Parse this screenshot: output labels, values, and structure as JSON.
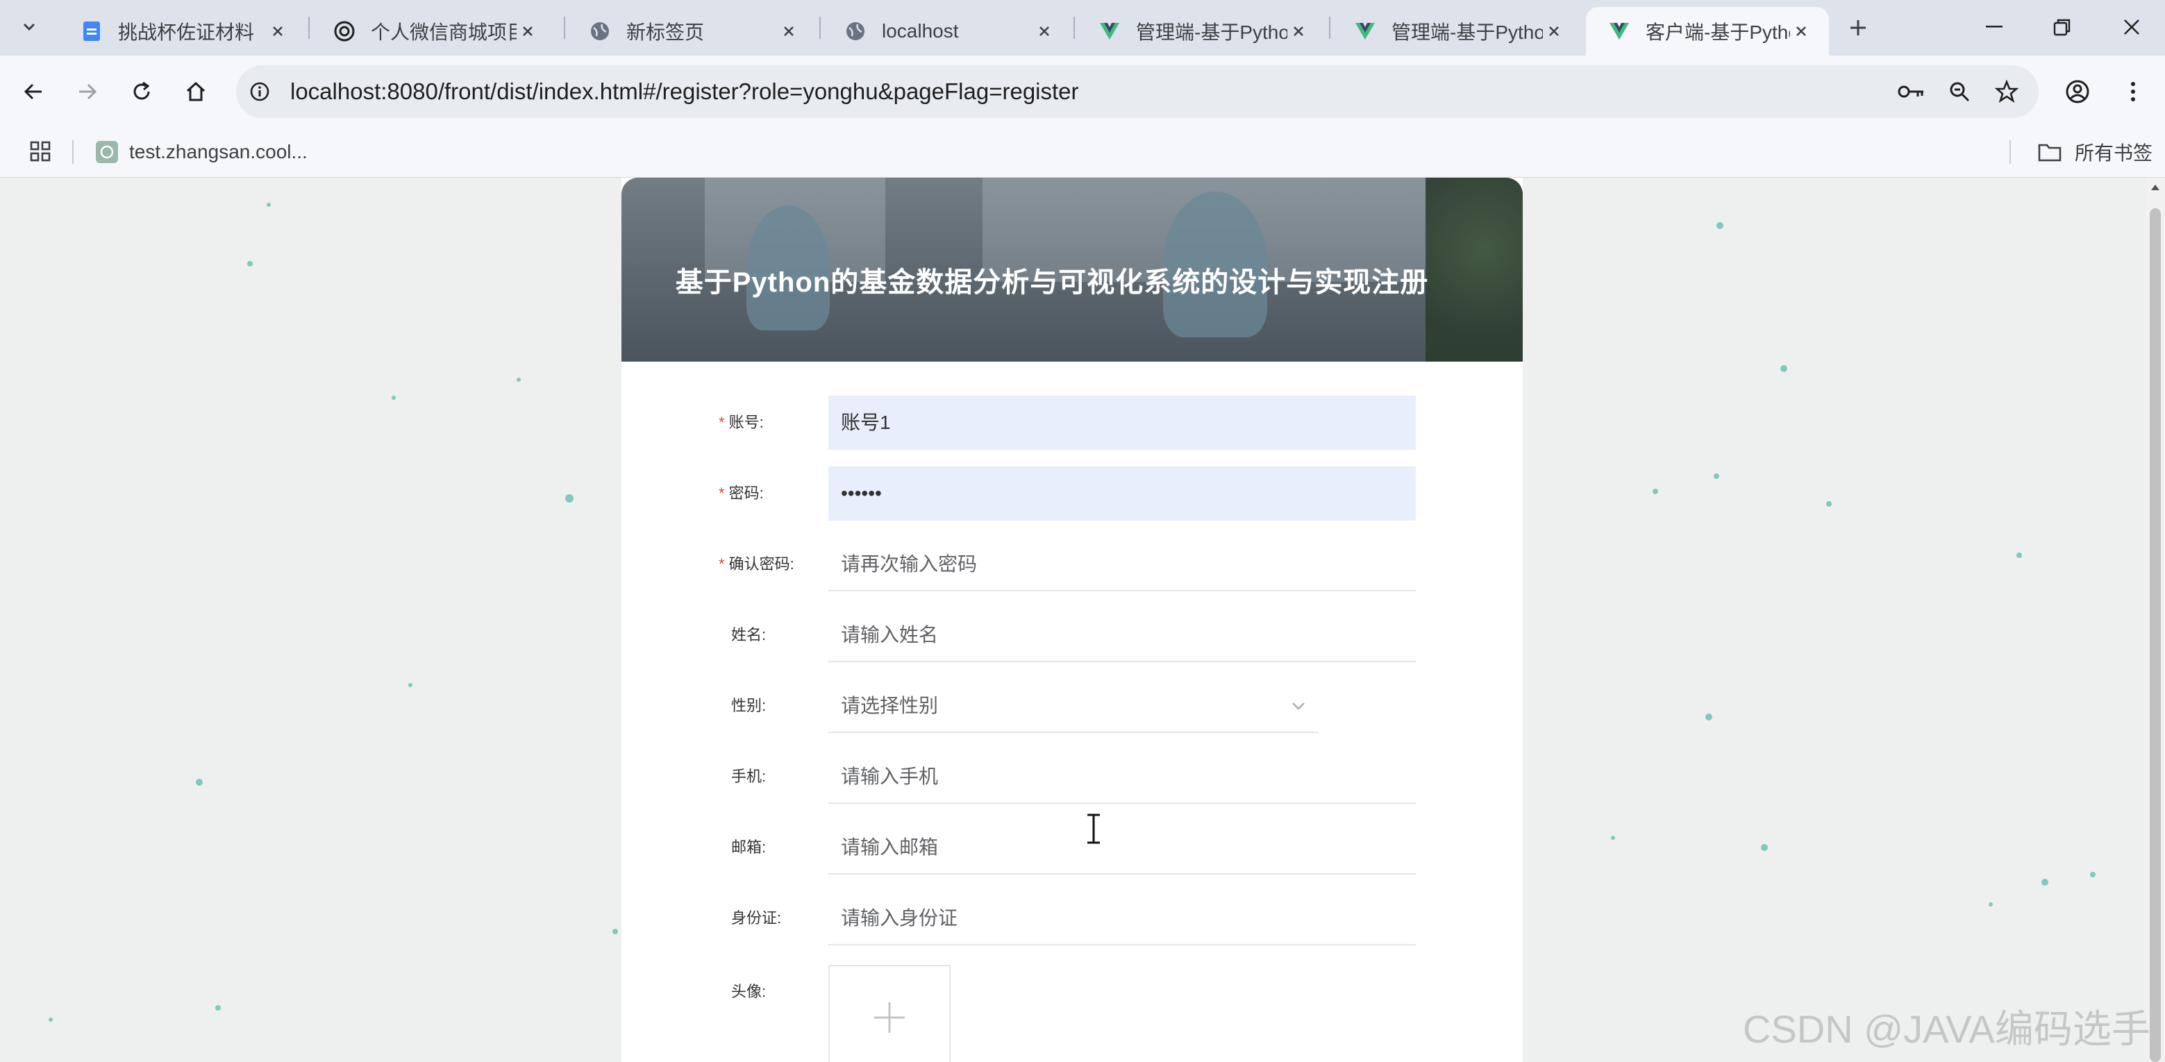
{
  "browser": {
    "tabs": [
      {
        "title": "挑战杯佐证材料",
        "icon": "docs-icon",
        "active": false
      },
      {
        "title": "个人微信商城项目",
        "icon": "openai-icon",
        "active": false
      },
      {
        "title": "新标签页",
        "icon": "globe-icon",
        "active": false
      },
      {
        "title": "localhost",
        "icon": "globe-icon",
        "active": false
      },
      {
        "title": "管理端-基于Pytho",
        "icon": "vue-icon",
        "active": false
      },
      {
        "title": "管理端-基于Pytho",
        "icon": "vue-icon",
        "active": false
      },
      {
        "title": "客户端-基于Pytho",
        "icon": "vue-icon",
        "active": true
      }
    ],
    "url": "localhost:8080/front/dist/index.html#/register?role=yonghu&pageFlag=register",
    "bookmarks": [
      {
        "label": "test.zhangsan.cool..."
      }
    ],
    "all_bookmarks_label": "所有书签"
  },
  "page": {
    "title": "基于Python的基金数据分析与可视化系统的设计与实现注册",
    "fields": [
      {
        "label": "账号:",
        "required": true,
        "value": "账号1",
        "placeholder": "",
        "type": "text"
      },
      {
        "label": "密码:",
        "required": true,
        "value": "••••••",
        "placeholder": "",
        "type": "password"
      },
      {
        "label": "确认密码:",
        "required": true,
        "value": "",
        "placeholder": "请再次输入密码",
        "type": "password"
      },
      {
        "label": "姓名:",
        "required": false,
        "value": "",
        "placeholder": "请输入姓名",
        "type": "text"
      },
      {
        "label": "性别:",
        "required": false,
        "value": "",
        "placeholder": "请选择性别",
        "type": "select"
      },
      {
        "label": "手机:",
        "required": false,
        "value": "",
        "placeholder": "请输入手机",
        "type": "text"
      },
      {
        "label": "邮箱:",
        "required": false,
        "value": "",
        "placeholder": "请输入邮箱",
        "type": "text"
      },
      {
        "label": "身份证:",
        "required": false,
        "value": "",
        "placeholder": "请输入身份证",
        "type": "text"
      },
      {
        "label": "头像:",
        "required": false,
        "value": "",
        "placeholder": "",
        "type": "upload"
      }
    ],
    "required_mark": "*"
  },
  "watermark": "CSDN @JAVA编码选手",
  "colors": {
    "filled_input_bg": "#e8eefb",
    "required": "#e64242",
    "dots": "#7fc9bd"
  }
}
